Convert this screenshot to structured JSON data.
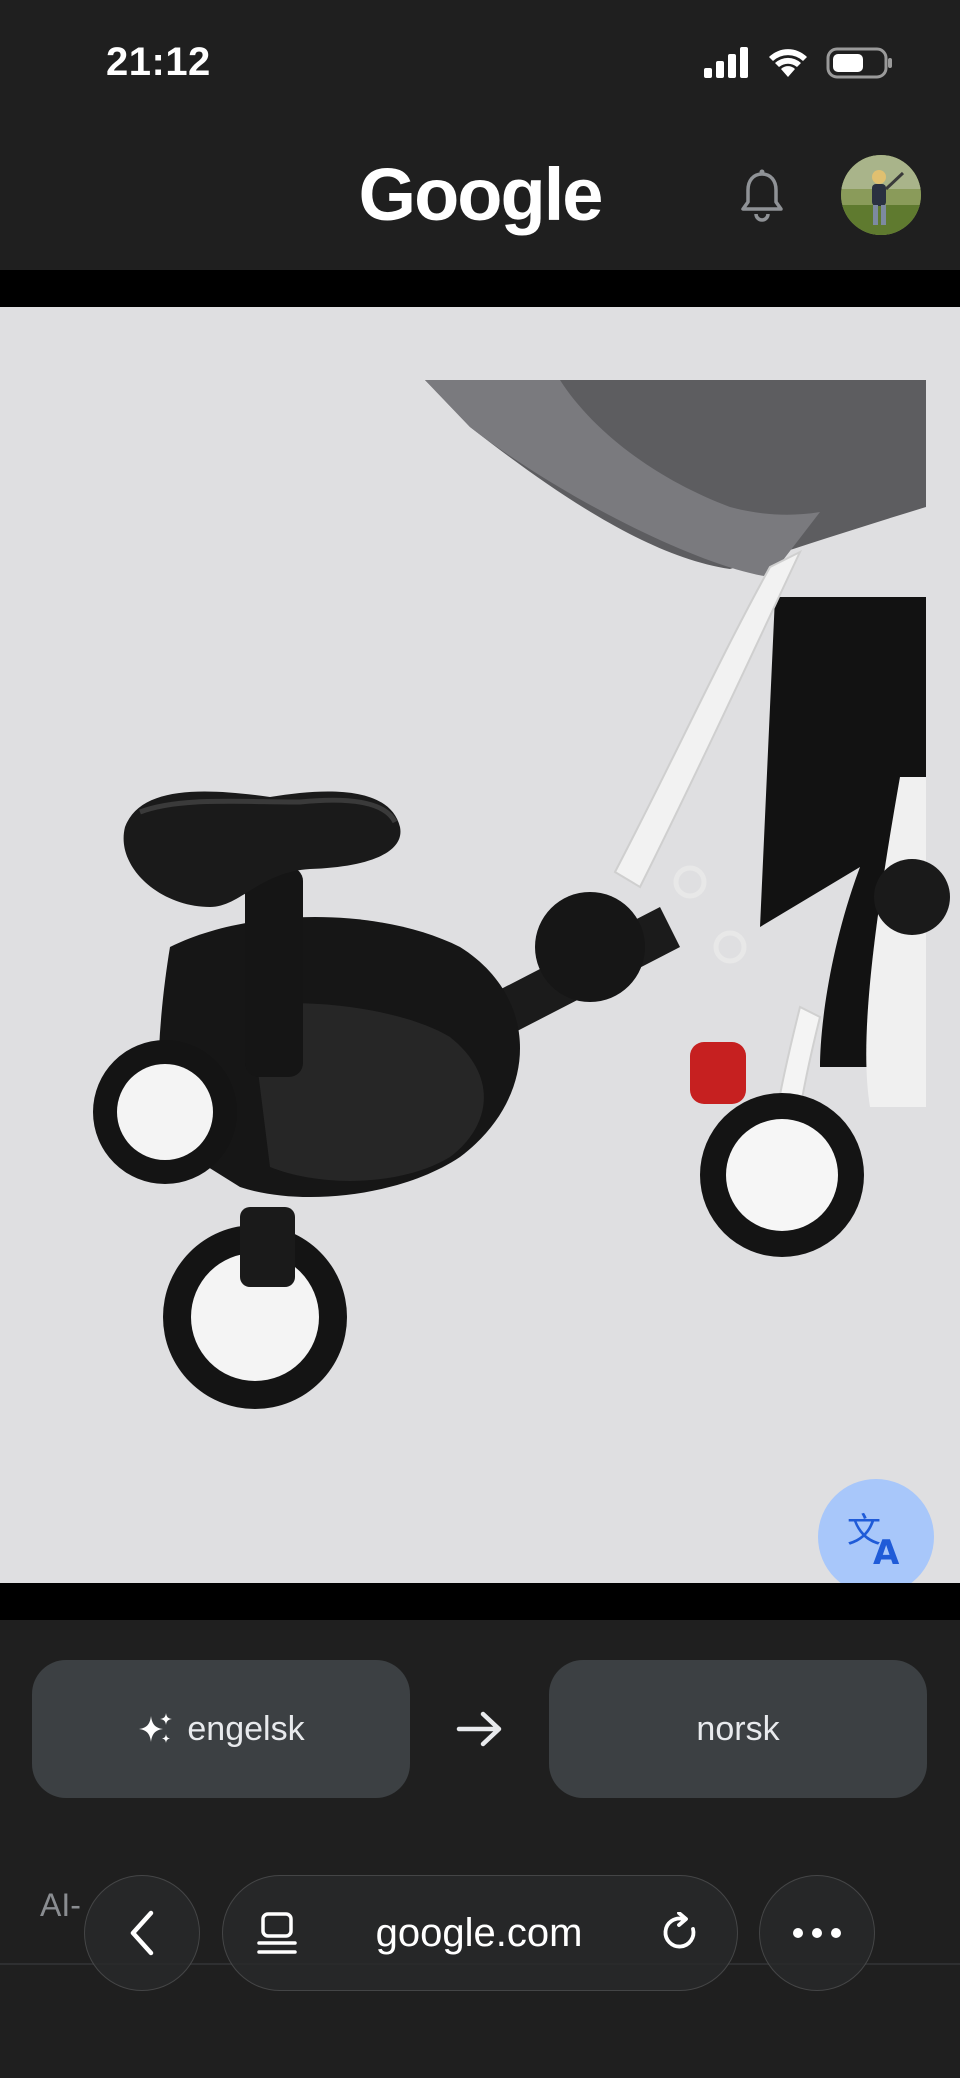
{
  "status_bar": {
    "time": "21:12"
  },
  "header": {
    "logo": "Google"
  },
  "image": {
    "subject": "stroller ride-on board"
  },
  "translate": {
    "source_language": "engelsk",
    "target_language": "norsk"
  },
  "below": {
    "ai_label": "AI-"
  },
  "browser": {
    "url": "google.com"
  },
  "colors": {
    "fab": "#a8c7fa",
    "pill": "#3c4043",
    "background": "#1f1f1f"
  }
}
